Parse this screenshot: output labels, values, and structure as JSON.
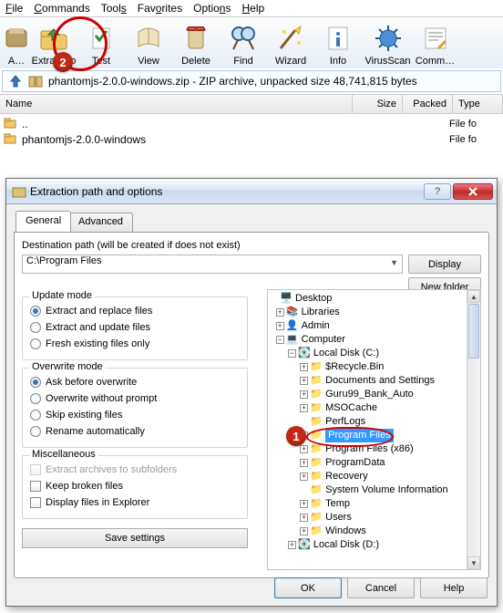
{
  "menu": {
    "file": "File",
    "commands": "Commands",
    "tools": "Tools",
    "favorites": "Favorites",
    "options": "Options",
    "help": "Help"
  },
  "toolbar": {
    "add": "A…",
    "extract": "Extract To",
    "test": "Test",
    "view": "View",
    "delete": "Delete",
    "find": "Find",
    "wizard": "Wizard",
    "info": "Info",
    "virus": "VirusScan",
    "comment": "Comm…"
  },
  "location": {
    "path": "phantomjs-2.0.0-windows.zip - ZIP archive, unpacked size 48,741,815 bytes"
  },
  "filehdr": {
    "name": "Name",
    "size": "Size",
    "packed": "Packed",
    "type": "Type"
  },
  "files": [
    {
      "name": "..",
      "type": "File fo"
    },
    {
      "name": "phantomjs-2.0.0-windows",
      "type": "File fo"
    }
  ],
  "dialog": {
    "title": "Extraction path and options",
    "tabs": {
      "general": "General",
      "advanced": "Advanced"
    },
    "dest_label": "Destination path (will be created if does not exist)",
    "dest_value": "C:\\Program Files",
    "display_btn": "Display",
    "newfolder_btn": "New folder",
    "update_mode": {
      "title": "Update mode",
      "opt1": "Extract and replace files",
      "opt2": "Extract and update files",
      "opt3": "Fresh existing files only"
    },
    "overwrite_mode": {
      "title": "Overwrite mode",
      "opt1": "Ask before overwrite",
      "opt2": "Overwrite without prompt",
      "opt3": "Skip existing files",
      "opt4": "Rename automatically"
    },
    "misc": {
      "title": "Miscellaneous",
      "opt1": "Extract archives to subfolders",
      "opt2": "Keep broken files",
      "opt3": "Display files in Explorer"
    },
    "save_btn": "Save settings",
    "tree": {
      "desktop": "Desktop",
      "libraries": "Libraries",
      "admin": "Admin",
      "computer": "Computer",
      "cdrive": "Local Disk (C:)",
      "items": [
        "$Recycle.Bin",
        "Documents and Settings",
        "Guru99_Bank_Auto",
        "MSOCache",
        "PerfLogs",
        "Program Files",
        "Program Files (x86)",
        "ProgramData",
        "Recovery",
        "System Volume Information",
        "Temp",
        "Users",
        "Windows"
      ],
      "ddrive": "Local Disk (D:)"
    },
    "ok": "OK",
    "cancel": "Cancel",
    "help": "Help"
  },
  "steps": {
    "one": "1",
    "two": "2"
  }
}
